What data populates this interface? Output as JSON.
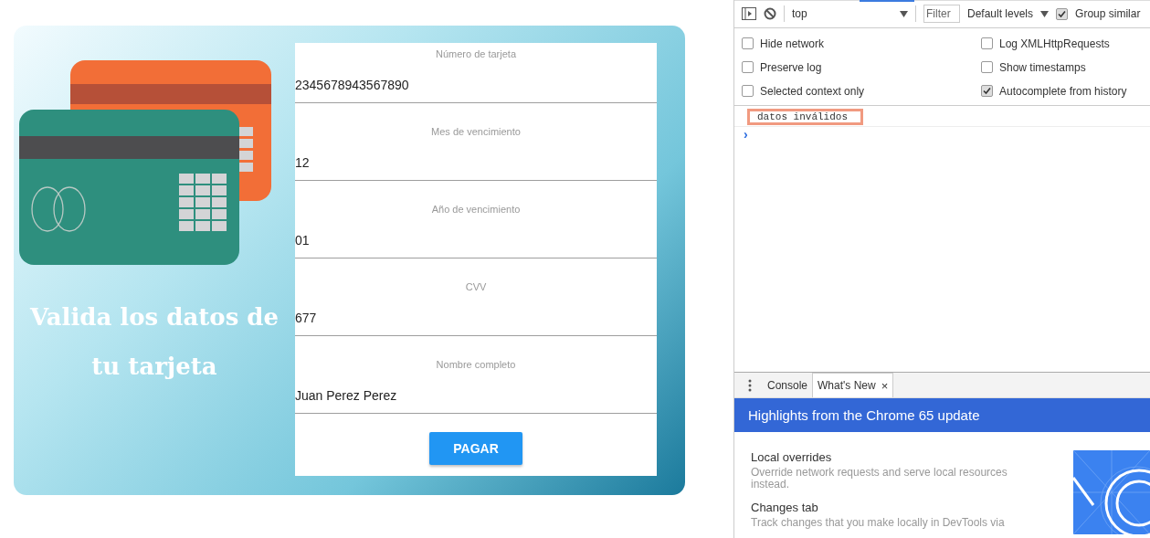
{
  "card_form": {
    "heading": "Valida los datos de tu tarjeta",
    "fields": [
      {
        "label": "Número de tarjeta",
        "value": "2345678943567890"
      },
      {
        "label": "Mes de vencimiento",
        "value": "12"
      },
      {
        "label": "Año de vencimiento",
        "value": "01"
      },
      {
        "label": "CVV",
        "value": "677"
      },
      {
        "label": "Nombre completo",
        "value": "Juan Perez Perez"
      }
    ],
    "button": "PAGAR"
  },
  "devtools": {
    "toolbar": {
      "context": "top",
      "filter_placeholder": "Filter",
      "levels": "Default levels",
      "group_similar": {
        "label": "Group similar",
        "checked": true
      }
    },
    "options": [
      {
        "label": "Hide network",
        "checked": false
      },
      {
        "label": "Log XMLHttpRequests",
        "checked": false
      },
      {
        "label": "Preserve log",
        "checked": false
      },
      {
        "label": "Show timestamps",
        "checked": false
      },
      {
        "label": "Selected context only",
        "checked": false
      },
      {
        "label": "Autocomplete from history",
        "checked": true
      }
    ],
    "messages": [
      {
        "text": "datos inválidos",
        "highlighted": true
      }
    ],
    "prompt": "›",
    "drawer_tabs": [
      {
        "label": "Console",
        "selected": false
      },
      {
        "label": "What's New",
        "selected": true,
        "close": "×"
      }
    ],
    "banner": "Highlights from the Chrome 65 update",
    "features": [
      {
        "title": "Local overrides",
        "description": "Override network requests and serve local resources instead."
      },
      {
        "title": "Changes tab",
        "description": "Track changes that you make locally in DevTools via"
      }
    ]
  }
}
